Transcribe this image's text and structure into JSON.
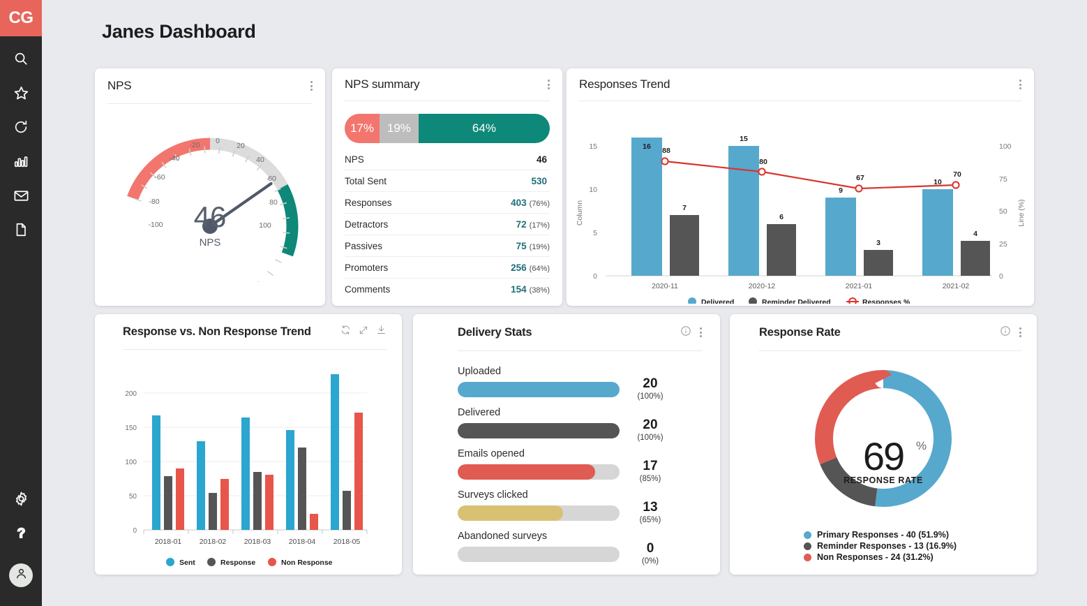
{
  "colors": {
    "brand_red": "#e8655c",
    "sidebar_bg": "#2a2a2a",
    "page_bg": "#e9eaee",
    "blue": "#57a8cd",
    "dark_gray": "#555555",
    "red": "#e05b52",
    "teal": "#0e8878",
    "gray": "#bdbdbd",
    "gold": "#d9c173",
    "track_gray": "#d6d6d6",
    "line_red": "#d9352c"
  },
  "sidebar": {
    "logo": "CG",
    "top_items": [
      {
        "name": "search-icon",
        "label": "Search"
      },
      {
        "name": "star-icon",
        "label": "Favorites"
      },
      {
        "name": "refresh-icon",
        "label": "Refresh"
      },
      {
        "name": "bar-chart-icon",
        "label": "Reports"
      },
      {
        "name": "mail-icon",
        "label": "Messages"
      },
      {
        "name": "document-icon",
        "label": "Documents"
      }
    ],
    "bottom_items": [
      {
        "name": "gear-icon",
        "label": "Settings"
      },
      {
        "name": "help-icon",
        "label": "Help"
      }
    ],
    "avatar": "user-icon"
  },
  "header": {
    "title": "Janes Dashboard"
  },
  "cards": {
    "nps": {
      "title": "NPS",
      "value": "46",
      "label": "NPS",
      "gauge": {
        "min": -100,
        "max": 100,
        "needle_value": 46,
        "ticks": [
          -100,
          -80,
          -60,
          -40,
          -20,
          0,
          20,
          40,
          60,
          80,
          100
        ],
        "bands": [
          {
            "from": -100,
            "to": 0,
            "color": "#f2756e"
          },
          {
            "from": 0,
            "to": 45,
            "color": "#dcdcdc"
          },
          {
            "from": 45,
            "to": 100,
            "color": "#0e8878"
          }
        ]
      }
    },
    "nps_summary": {
      "title": "NPS summary",
      "bar": [
        {
          "label": "17%",
          "value": 17,
          "color": "#f2756e"
        },
        {
          "label": "19%",
          "value": 19,
          "color": "#bdbdbd"
        },
        {
          "label": "64%",
          "value": 64,
          "color": "#0e8878"
        }
      ],
      "rows": [
        {
          "label": "NPS",
          "value": "46",
          "pct": "",
          "value_color": "#1c1c1c"
        },
        {
          "label": "Total Sent",
          "value": "530",
          "pct": "",
          "value_color": "#1f6f7a"
        },
        {
          "label": "Responses",
          "value": "403",
          "pct": "(76%)",
          "value_color": "#1f6f7a"
        },
        {
          "label": "Detractors",
          "value": "72",
          "pct": "(17%)",
          "value_color": "#1f6f7a"
        },
        {
          "label": "Passives",
          "value": "75",
          "pct": "(19%)",
          "value_color": "#1f6f7a"
        },
        {
          "label": "Promoters",
          "value": "256",
          "pct": "(64%)",
          "value_color": "#1f6f7a"
        },
        {
          "label": "Comments",
          "value": "154",
          "pct": "(38%)",
          "value_color": "#1f6f7a"
        }
      ]
    },
    "responses_trend": {
      "title": "Responses Trend"
    },
    "response_vs_non": {
      "title": "Response vs. Non Response Trend",
      "icons": [
        "refresh-icon",
        "expand-icon",
        "download-icon"
      ]
    },
    "delivery_stats": {
      "title": "Delivery Stats",
      "rows": [
        {
          "label": "Uploaded",
          "value": "20",
          "pct": "(100%)",
          "fill": 100,
          "color": "#57a8cd"
        },
        {
          "label": "Delivered",
          "value": "20",
          "pct": "(100%)",
          "fill": 100,
          "color": "#555555"
        },
        {
          "label": "Emails opened",
          "value": "17",
          "pct": "(85%)",
          "fill": 85,
          "color": "#e05b52"
        },
        {
          "label": "Surveys clicked",
          "value": "13",
          "pct": "(65%)",
          "fill": 65,
          "color": "#d9c173"
        },
        {
          "label": "Abandoned surveys",
          "value": "0",
          "pct": "(0%)",
          "fill": 0,
          "color": "#d6d6d6"
        }
      ]
    },
    "response_rate": {
      "title": "Response Rate",
      "center_value": "69",
      "center_pct_sign": "%",
      "center_caption": "RESPONSE RATE"
    }
  },
  "chart_data": [
    {
      "id": "responses_trend",
      "type": "bar",
      "title": "Responses Trend",
      "categories": [
        "2020-11",
        "2020-12",
        "2021-01",
        "2021-02"
      ],
      "series": [
        {
          "name": "Delivered",
          "type": "bar",
          "color": "#57a8cd",
          "axis": "left",
          "values": [
            16,
            15,
            9,
            10
          ]
        },
        {
          "name": "Reminder Delivered",
          "type": "bar",
          "color": "#555555",
          "axis": "left",
          "values": [
            7,
            6,
            3,
            4
          ]
        },
        {
          "name": "Responses %",
          "type": "line",
          "color": "#d9352c",
          "axis": "right",
          "values": [
            88,
            80,
            67,
            70
          ]
        }
      ],
      "ylabel": "Column",
      "y2label": "Line (%)",
      "ylim": [
        0,
        16
      ],
      "y2lim": [
        0,
        100
      ],
      "yticks": [
        0,
        5,
        10,
        15
      ],
      "y2ticks": [
        0,
        25,
        50,
        75,
        100
      ],
      "xlabel": "",
      "grid": false,
      "legend": "bottom",
      "data_labels": true
    },
    {
      "id": "response_vs_non_response",
      "type": "bar",
      "title": "Response vs. Non Response Trend",
      "categories": [
        "2018-01",
        "2018-02",
        "2018-03",
        "2018-04",
        "2018-05"
      ],
      "series": [
        {
          "name": "Sent",
          "color": "#2ba6ce",
          "values": [
            167,
            130,
            164,
            146,
            228
          ]
        },
        {
          "name": "Response",
          "color": "#555555",
          "values": [
            79,
            54,
            85,
            121,
            57
          ]
        },
        {
          "name": "Non Response",
          "color": "#e8554b",
          "values": [
            90,
            75,
            81,
            24,
            172
          ]
        }
      ],
      "xlabel": "",
      "ylabel": "",
      "ylim": [
        0,
        240
      ],
      "yticks": [
        0,
        50,
        100,
        150,
        200
      ],
      "grid": true,
      "legend": "bottom",
      "data_labels": false
    },
    {
      "id": "delivery_stats",
      "type": "bar",
      "title": "Delivery Stats",
      "categories": [
        "Uploaded",
        "Delivered",
        "Emails opened",
        "Surveys clicked",
        "Abandoned surveys"
      ],
      "values": [
        20,
        20,
        17,
        13,
        0
      ],
      "percents": [
        "(100%)",
        "(100%)",
        "(85%)",
        "(65%)",
        "(0%)"
      ],
      "colors": [
        "#57a8cd",
        "#555555",
        "#e05b52",
        "#d9c173",
        "#d6d6d6"
      ],
      "ylim": [
        0,
        20
      ],
      "grid": false,
      "legend": "none"
    },
    {
      "id": "response_rate",
      "type": "pie",
      "title": "Response Rate",
      "center_label": "69%",
      "center_caption": "RESPONSE RATE",
      "slices": [
        {
          "name": "Primary Responses",
          "value": 40,
          "percent": 51.9,
          "color": "#57a8cd",
          "legend": "Primary Responses - 40 (51.9%)"
        },
        {
          "name": "Reminder Responses",
          "value": 13,
          "percent": 16.9,
          "color": "#555555",
          "legend": "Reminder Responses - 13 (16.9%)"
        },
        {
          "name": "Non Responses",
          "value": 24,
          "percent": 31.2,
          "color": "#e05b52",
          "legend": "Non Responses - 24 (31.2%)"
        }
      ],
      "legend": "bottom"
    }
  ]
}
